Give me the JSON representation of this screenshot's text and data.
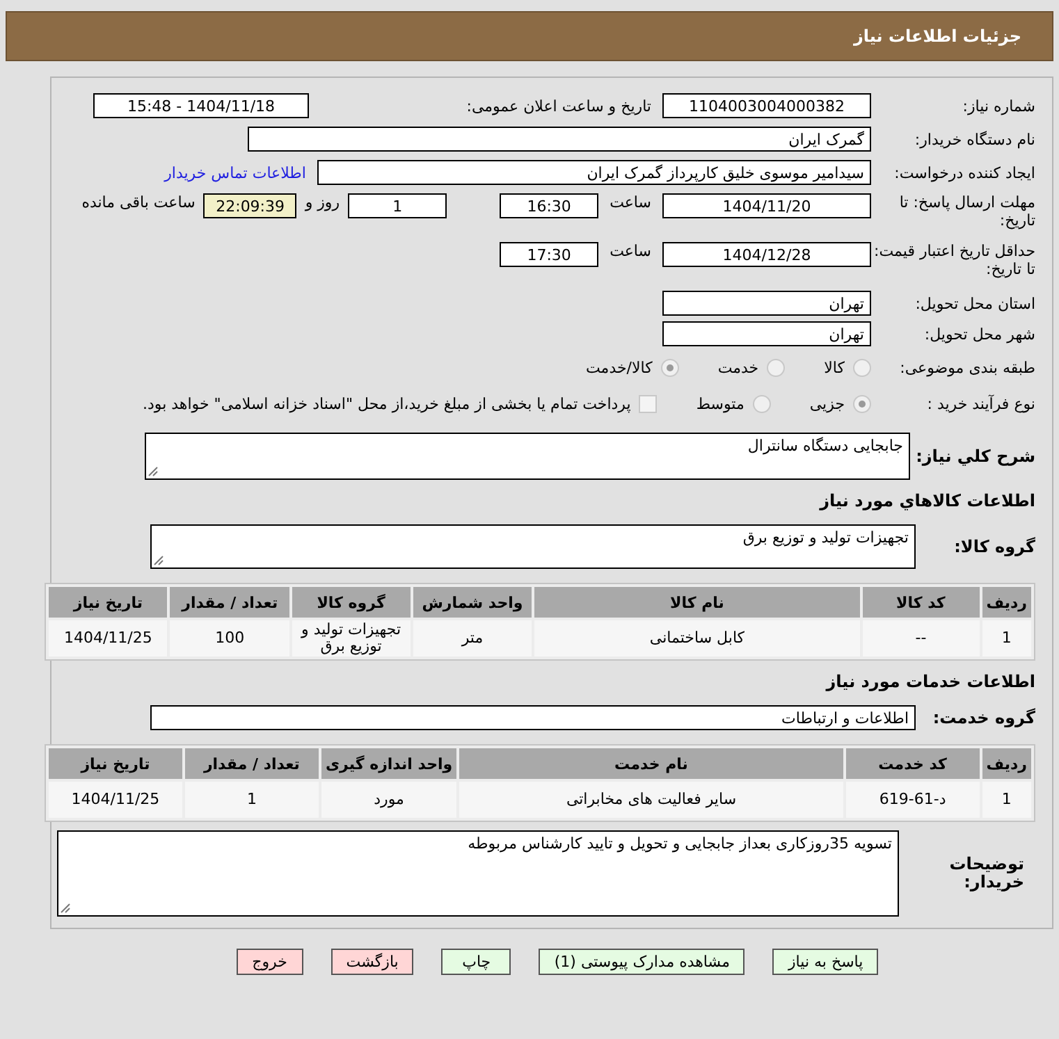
{
  "header": {
    "title": "جزئیات اطلاعات نیاز"
  },
  "need_number": {
    "label": "شماره نیاز:",
    "value": "1104003004000382"
  },
  "announce": {
    "label": "تاریخ و ساعت اعلان عمومی:",
    "value": "1404/11/18 - 15:48"
  },
  "buyer_org": {
    "label": "نام دستگاه خریدار:",
    "value": "گمرک ایران"
  },
  "requester": {
    "label": "ایجاد کننده درخواست:",
    "value": "سیدامیر موسوی خلیق کارپرداز گمرک ایران",
    "link": "اطلاعات تماس خریدار"
  },
  "deadline": {
    "label": "مهلت ارسال پاسخ: تا تاریخ:",
    "date": "1404/11/20",
    "time_label": "ساعت",
    "time": "16:30",
    "days": "1",
    "days_label": "روز و",
    "remaining": "22:09:39",
    "remaining_label": "ساعت باقی مانده"
  },
  "validity": {
    "label": "حداقل تاریخ اعتبار قیمت: تا تاریخ:",
    "date": "1404/12/28",
    "time_label": "ساعت",
    "time": "17:30"
  },
  "province": {
    "label": "استان محل تحویل:",
    "value": "تهران"
  },
  "city": {
    "label": "شهر محل تحویل:",
    "value": "تهران"
  },
  "category": {
    "label": "طبقه بندی موضوعی:",
    "options": [
      {
        "label": "كالا",
        "selected": false
      },
      {
        "label": "خدمت",
        "selected": false
      },
      {
        "label": "كالا/خدمت",
        "selected": true
      }
    ]
  },
  "purchase_type": {
    "label": "نوع فرآیند خرید :",
    "options": [
      {
        "label": "جزیی",
        "selected": true
      },
      {
        "label": "متوسط",
        "selected": false
      }
    ],
    "payment": {
      "label": "پرداخت تمام یا بخشی از مبلغ خرید،از محل \"اسناد خزانه اسلامی\" خواهد بود.",
      "checked": false
    }
  },
  "description": {
    "label": "شرح کلي نياز:",
    "value": "جابجایی دستگاه سانترال"
  },
  "goods_title": "اطلاعات کالاهاي مورد نياز",
  "goods_group": {
    "label": "گروه کالا:",
    "value": "تجهیزات تولید و توزیع برق"
  },
  "goods_table": {
    "columns": [
      "ردیف",
      "کد کالا",
      "نام کالا",
      "واحد شمارش",
      "گروه کالا",
      "تعداد / مقدار",
      "تاریخ نیاز"
    ],
    "rows": [
      [
        "1",
        "--",
        "کابل ساختمانی",
        "متر",
        "تجهیزات تولید و توزیع برق",
        "100",
        "1404/11/25"
      ]
    ]
  },
  "services_title": "اطلاعات خدمات مورد نياز",
  "service_group": {
    "label": "گروه خدمت:",
    "value": "اطلاعات و ارتباطات"
  },
  "services_table": {
    "columns": [
      "ردیف",
      "کد خدمت",
      "نام خدمت",
      "واحد اندازه گیری",
      "تعداد / مقدار",
      "تاریخ نیاز"
    ],
    "rows": [
      [
        "1",
        "د-61-619",
        "سایر فعالیت های مخابراتی",
        "مورد",
        "1",
        "1404/11/25"
      ]
    ]
  },
  "buyer_notes": {
    "label": "توضیحات خریدار:",
    "value": "تسویه 35روزکاری بعداز جابجایی و تحویل و تایید کارشناس مربوطه"
  },
  "buttons": [
    {
      "label": "پاسخ به نیاز",
      "kind": "green"
    },
    {
      "label": "مشاهده مدارک پیوستی (1)",
      "kind": "green"
    },
    {
      "label": "چاپ",
      "kind": "green"
    },
    {
      "label": "بازگشت",
      "kind": "red"
    },
    {
      "label": "خروج",
      "kind": "red"
    }
  ]
}
